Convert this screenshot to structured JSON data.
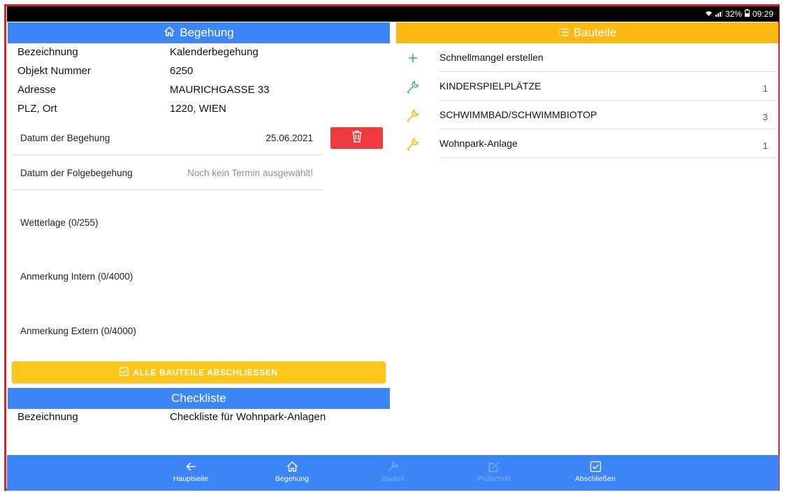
{
  "status": {
    "battery": "32%",
    "time": "09:29"
  },
  "begehung": {
    "title": "Begehung",
    "info": [
      {
        "label": "Bezeichnung",
        "value": "Kalenderbegehung"
      },
      {
        "label": "Objekt Nummer",
        "value": "6250"
      },
      {
        "label": "Adresse",
        "value": "MAURICHGASSE 33"
      },
      {
        "label": "PLZ, Ort",
        "value": "1220, WIEN"
      }
    ],
    "date_label": "Datum der Begehung",
    "date_value": "25.06.2021",
    "followup_label": "Datum der Folgebegehung",
    "followup_placeholder": "Noch kein Termin ausgewählt!",
    "weather_label": "Wetterlage (0/255)",
    "note_internal_label": "Anmerkung Intern (0/4000)",
    "note_external_label": "Anmerkung Extern (0/4000)",
    "close_all_label": "ALLE BAUTEILE ABSCHLIESSEN"
  },
  "checkliste": {
    "title": "Checkliste",
    "label": "Bezeichnung",
    "value": "Checkliste für Wohnpark-Anlagen"
  },
  "bauteile": {
    "title": "Bauteile",
    "quick_add_label": "Schnellmangel erstellen",
    "items": [
      {
        "label": "KINDERSPIELPLÄTZE",
        "count": "1",
        "icon": "wrench-icon",
        "color": "#3cc46a"
      },
      {
        "label": "SCHWIMMBAD/SCHWIMMBIOTOP",
        "count": "3",
        "icon": "wrench-icon",
        "color": "#fcb912"
      },
      {
        "label": "Wohnpark-Anlage",
        "count": "1",
        "icon": "wrench-icon",
        "color": "#fcb912"
      }
    ]
  },
  "nav": [
    {
      "label": "Hauptseite",
      "icon": "arrow-left-icon",
      "enabled": true
    },
    {
      "label": "Begehung",
      "icon": "home-icon",
      "enabled": true
    },
    {
      "label": "Bauteil",
      "icon": "wrench-icon",
      "enabled": false
    },
    {
      "label": "Prüfschritt",
      "icon": "edit-icon",
      "enabled": false
    },
    {
      "label": "Abschließen",
      "icon": "checkbox-icon",
      "enabled": true
    }
  ],
  "colors": {
    "primary": "#3d86f7",
    "accent": "#fcb912",
    "danger": "#ee3b3f",
    "frame": "#d6262b"
  }
}
